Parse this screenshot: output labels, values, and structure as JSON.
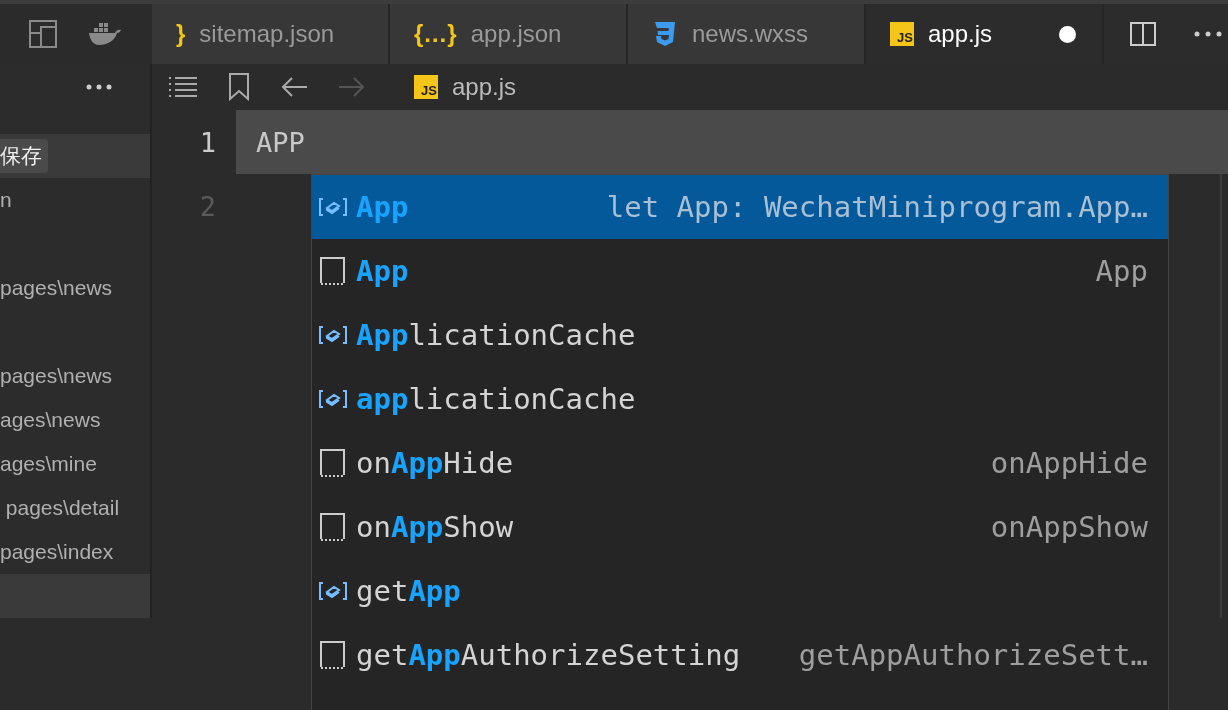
{
  "tabs": [
    {
      "label": "sitemap.json",
      "kind": "json",
      "icon_label": "}",
      "selected": false,
      "modified": false
    },
    {
      "label": "app.json",
      "kind": "json",
      "icon_label": "{…}",
      "selected": false,
      "modified": false
    },
    {
      "label": "news.wxss",
      "kind": "css",
      "selected": false,
      "modified": false
    },
    {
      "label": "app.js",
      "kind": "js",
      "icon_label": "JS",
      "selected": true,
      "modified": true
    }
  ],
  "breadcrumb": {
    "back_enabled": true,
    "forward_enabled": false,
    "file": {
      "icon_label": "JS",
      "label": "app.js"
    }
  },
  "sidebar": {
    "header": "保存",
    "items": [
      {
        "label": "n"
      },
      {
        "label": "pages\\news"
      },
      {
        "label": "pages\\news"
      },
      {
        "label": "ages\\news"
      },
      {
        "label": "ages\\mine"
      },
      {
        "label": " pages\\detail"
      },
      {
        "label": "pages\\index"
      }
    ]
  },
  "editor": {
    "lines": [
      {
        "number": "1",
        "text": "APP",
        "current": true
      },
      {
        "number": "2",
        "current": false
      }
    ]
  },
  "suggestions": [
    {
      "kind": "variable",
      "match": "App",
      "detail": "let App: WechatMiniprogram.App…",
      "selected": true
    },
    {
      "kind": "text",
      "match": "App",
      "detail": "App",
      "selected": false
    },
    {
      "kind": "variable",
      "match": "App",
      "after": "licationCache",
      "selected": false
    },
    {
      "kind": "variable",
      "match": "app",
      "after": "licationCache",
      "selected": false
    },
    {
      "kind": "text",
      "before": "on",
      "match": "App",
      "after": "Hide",
      "detail": "onAppHide",
      "selected": false
    },
    {
      "kind": "text",
      "before": "on",
      "match": "App",
      "after": "Show",
      "detail": "onAppShow",
      "selected": false
    },
    {
      "kind": "variable",
      "before": "get",
      "match": "App",
      "selected": false
    },
    {
      "kind": "text",
      "before": "get",
      "match": "App",
      "after": "AuthorizeSetting",
      "detail": "getAppAuthorizeSett…",
      "selected": false
    }
  ]
}
